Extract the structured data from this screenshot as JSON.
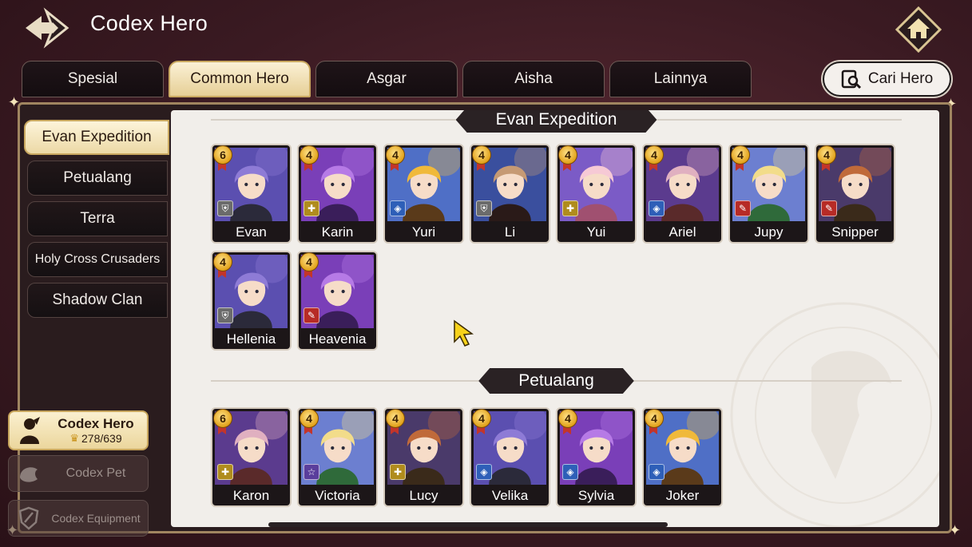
{
  "header": {
    "title": "Codex Hero"
  },
  "top_tabs": [
    {
      "label": "Spesial",
      "active": false
    },
    {
      "label": "Common Hero",
      "active": true
    },
    {
      "label": "Asgar",
      "active": false
    },
    {
      "label": "Aisha",
      "active": false
    },
    {
      "label": "Lainnya",
      "active": false
    }
  ],
  "search": {
    "label": "Cari Hero"
  },
  "side_tabs": [
    {
      "label": "Evan Expedition",
      "active": true
    },
    {
      "label": "Petualang",
      "active": false
    },
    {
      "label": "Terra",
      "active": false
    },
    {
      "label": "Holy Cross Crusaders",
      "active": false
    },
    {
      "label": "Shadow Clan",
      "active": false
    }
  ],
  "codex_menu": {
    "hero": {
      "label": "Codex Hero",
      "count": "278/639"
    },
    "pet": {
      "label": "Codex Pet"
    },
    "equipment": {
      "label": "Codex Equipment"
    }
  },
  "sections": [
    {
      "title": "Evan Expedition",
      "heroes": [
        {
          "name": "Evan",
          "stars": "6",
          "class": "defense"
        },
        {
          "name": "Karin",
          "stars": "4",
          "class": "support"
        },
        {
          "name": "Yuri",
          "stars": "4",
          "class": "magic"
        },
        {
          "name": "Li",
          "stars": "4",
          "class": "defense"
        },
        {
          "name": "Yui",
          "stars": "4",
          "class": "support"
        },
        {
          "name": "Ariel",
          "stars": "4",
          "class": "magic"
        },
        {
          "name": "Jupy",
          "stars": "4",
          "class": "attack"
        },
        {
          "name": "Snipper",
          "stars": "4",
          "class": "attack"
        },
        {
          "name": "Hellenia",
          "stars": "4",
          "class": "defense"
        },
        {
          "name": "Heavenia",
          "stars": "4",
          "class": "attack"
        }
      ]
    },
    {
      "title": "Petualang",
      "heroes": [
        {
          "name": "Karon",
          "stars": "6",
          "class": "support"
        },
        {
          "name": "Victoria",
          "stars": "4",
          "class": "universal"
        },
        {
          "name": "Lucy",
          "stars": "4",
          "class": "support"
        },
        {
          "name": "Velika",
          "stars": "4",
          "class": "magic"
        },
        {
          "name": "Sylvia",
          "stars": "4",
          "class": "magic"
        },
        {
          "name": "Joker",
          "stars": "4",
          "class": "magic"
        }
      ]
    }
  ],
  "colors": {
    "accent_gold": "#e6cf96",
    "panel_bg": "#f1eeea",
    "dark_tab": "#1a1114"
  }
}
